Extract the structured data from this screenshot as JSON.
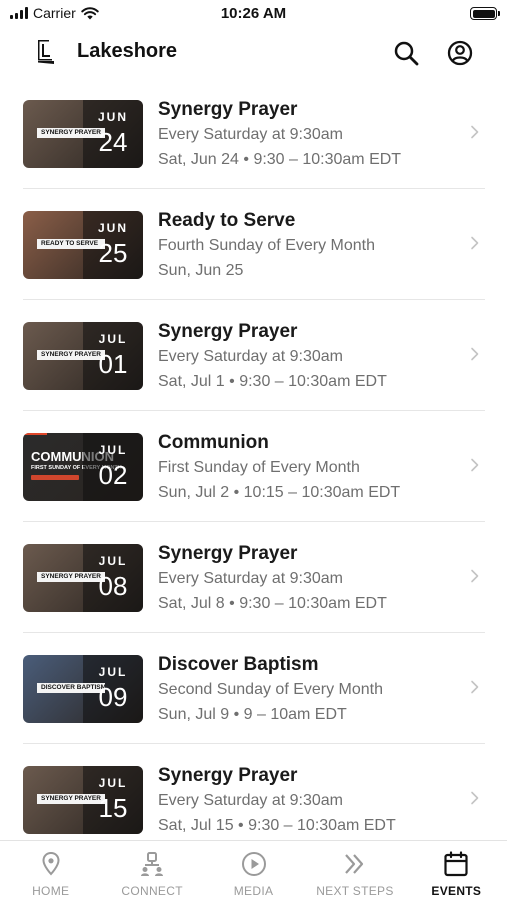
{
  "status_bar": {
    "carrier": "Carrier",
    "time": "10:26 AM"
  },
  "header": {
    "title": "Lakeshore"
  },
  "events": [
    {
      "title": "Synergy Prayer",
      "recurrence": "Every Saturday at 9:30am",
      "when": "Sat, Jun 24 • 9:30 – 10:30am EDT",
      "thumb": {
        "style": "banner",
        "banner": "SYNERGY PRAYER",
        "month": "JUN",
        "day": "24",
        "bg": "#6b5a4e"
      }
    },
    {
      "title": "Ready to Serve",
      "recurrence": "Fourth Sunday of Every Month",
      "when": "Sun, Jun 25",
      "thumb": {
        "style": "banner",
        "banner": "READY TO SERVE",
        "month": "JUN",
        "day": "25",
        "bg": "#8a5e48"
      }
    },
    {
      "title": "Synergy Prayer",
      "recurrence": "Every Saturday at 9:30am",
      "when": "Sat, Jul 1 • 9:30 – 10:30am EDT",
      "thumb": {
        "style": "banner",
        "banner": "SYNERGY PRAYER",
        "month": "JUL",
        "day": "01",
        "bg": "#6b5a4e"
      }
    },
    {
      "title": "Communion",
      "recurrence": "First Sunday of Every Month",
      "when": "Sun, Jul 2 • 10:15 – 10:30am EDT",
      "thumb": {
        "style": "communion",
        "big": "COMMUNION",
        "sub": "FIRST SUNDAY OF EVERY MONTH",
        "month": "JUL",
        "day": "02",
        "bg": "#2b2b2b"
      }
    },
    {
      "title": "Synergy Prayer",
      "recurrence": "Every Saturday at 9:30am",
      "when": "Sat, Jul 8 • 9:30 – 10:30am EDT",
      "thumb": {
        "style": "banner",
        "banner": "SYNERGY PRAYER",
        "month": "JUL",
        "day": "08",
        "bg": "#6b5a4e"
      }
    },
    {
      "title": "Discover Baptism",
      "recurrence": "Second Sunday of Every Month",
      "when": "Sun, Jul 9 • 9 – 10am EDT",
      "thumb": {
        "style": "banner",
        "banner": "DISCOVER BAPTISM",
        "month": "JUL",
        "day": "09",
        "bg": "#4a5d7a"
      }
    },
    {
      "title": "Synergy Prayer",
      "recurrence": "Every Saturday at 9:30am",
      "when": "Sat, Jul 15 • 9:30 – 10:30am EDT",
      "thumb": {
        "style": "banner",
        "banner": "SYNERGY PRAYER",
        "month": "JUL",
        "day": "15",
        "bg": "#6b5a4e"
      }
    }
  ],
  "tabs": [
    {
      "label": "HOME",
      "icon": "map-pin-icon",
      "active": false
    },
    {
      "label": "CONNECT",
      "icon": "people-icon",
      "active": false
    },
    {
      "label": "MEDIA",
      "icon": "play-circle-icon",
      "active": false
    },
    {
      "label": "NEXT STEPS",
      "icon": "double-chevron-icon",
      "active": false
    },
    {
      "label": "EVENTS",
      "icon": "calendar-icon",
      "active": true
    }
  ],
  "colors": {
    "text": "#1a1a1a",
    "secondary_text": "#6f6f6f",
    "tab_inactive": "#9a9a9a",
    "tab_active": "#111111",
    "accent": "#e0472a"
  }
}
